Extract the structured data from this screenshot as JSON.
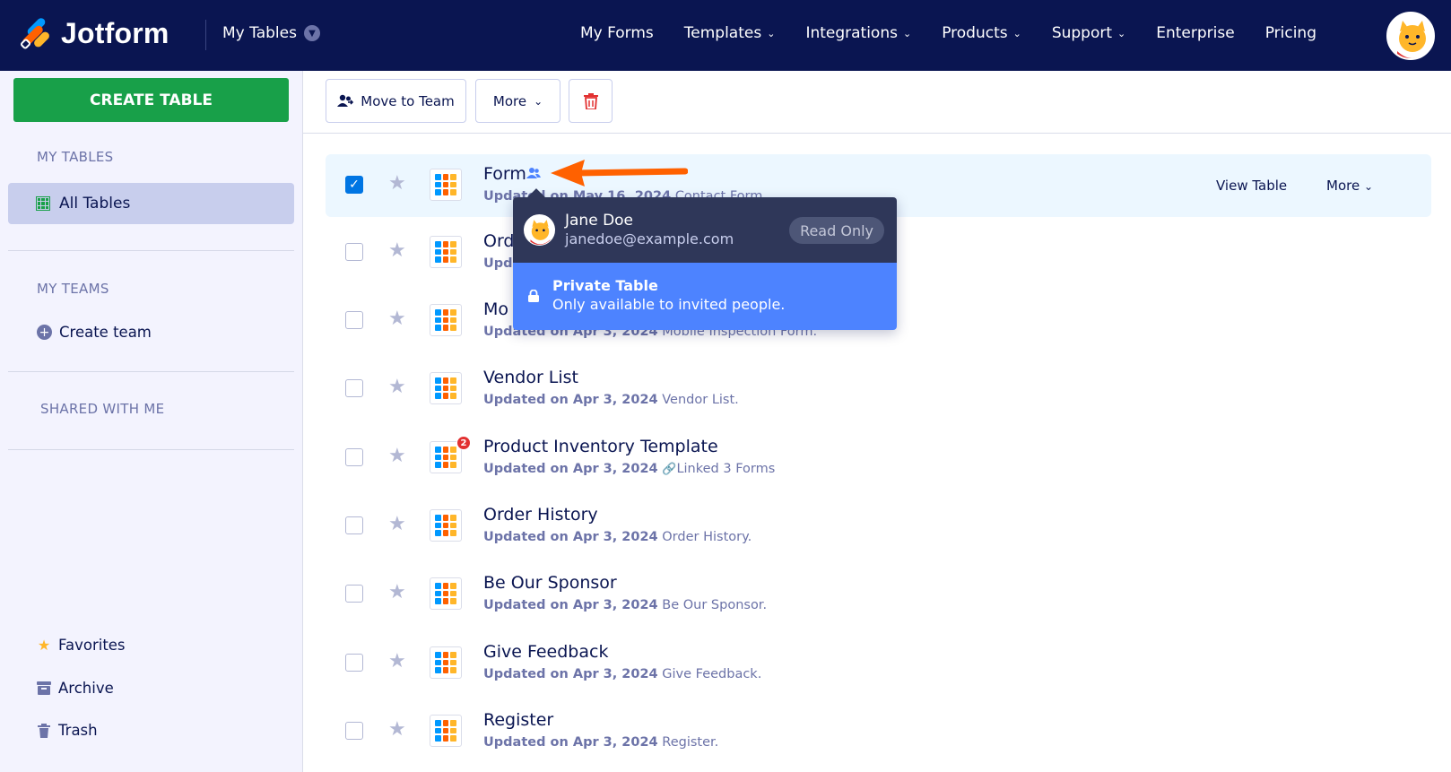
{
  "brand": {
    "name": "Jotform"
  },
  "header": {
    "section": "My Tables",
    "nav": [
      {
        "label": "My Forms",
        "dropdown": false
      },
      {
        "label": "Templates",
        "dropdown": true
      },
      {
        "label": "Integrations",
        "dropdown": true
      },
      {
        "label": "Products",
        "dropdown": true
      },
      {
        "label": "Support",
        "dropdown": true
      },
      {
        "label": "Enterprise",
        "dropdown": false
      },
      {
        "label": "Pricing",
        "dropdown": false
      }
    ]
  },
  "sidebar": {
    "create_label": "CREATE TABLE",
    "my_tables_title": "MY TABLES",
    "all_tables": "All Tables",
    "my_teams_title": "MY TEAMS",
    "create_team": "Create team",
    "shared_title": "SHARED WITH ME",
    "favorites": "Favorites",
    "archive": "Archive",
    "trash": "Trash"
  },
  "toolbar": {
    "move_to_team": "Move to Team",
    "more": "More"
  },
  "rows": [
    {
      "title": "Form",
      "date": "Updated on May 16, 2024",
      "detail": "Contact Form",
      "selected": true,
      "view": "View Table",
      "more": "More"
    },
    {
      "title": "Ord",
      "date": "Upda",
      "detail": "",
      "selected": false
    },
    {
      "title": "Mo",
      "date": "Updated on Apr 3, 2024",
      "detail": "Mobile Inspection Form.",
      "selected": false
    },
    {
      "title": "Vendor List",
      "date": "Updated on Apr 3, 2024",
      "detail": "Vendor List.",
      "selected": false
    },
    {
      "title": "Product Inventory Template",
      "date": "Updated on Apr 3, 2024",
      "detail": "Linked 3 Forms",
      "badge": "2",
      "selected": false
    },
    {
      "title": "Order History",
      "date": "Updated on Apr 3, 2024",
      "detail": "Order History.",
      "selected": false
    },
    {
      "title": "Be Our Sponsor",
      "date": "Updated on Apr 3, 2024",
      "detail": "Be Our Sponsor.",
      "selected": false
    },
    {
      "title": "Give Feedback",
      "date": "Updated on Apr 3, 2024",
      "detail": "Give Feedback.",
      "selected": false
    },
    {
      "title": "Register",
      "date": "Updated on Apr 3, 2024",
      "detail": "Register.",
      "selected": false
    }
  ],
  "popover": {
    "name": "Jane Doe",
    "email": "janedoe@example.com",
    "role": "Read Only",
    "private_title": "Private Table",
    "private_desc": "Only available to invited people."
  },
  "colors": {
    "nav_bg": "#0a1551",
    "create_green": "#18a049",
    "selected_row": "#ecf7ff",
    "checkbox_blue": "#0075e3",
    "arrow_orange": "#ff6100",
    "popover_dark": "#2f3759",
    "popover_blue": "#4d83ff"
  },
  "icons": [
    "people-share-icon",
    "trash-icon",
    "star-icon",
    "table-icon",
    "lock-icon",
    "link-icon",
    "favorites-star-icon",
    "archive-icon",
    "grid-icon",
    "plus-circle-icon",
    "chevron-down-icon"
  ]
}
